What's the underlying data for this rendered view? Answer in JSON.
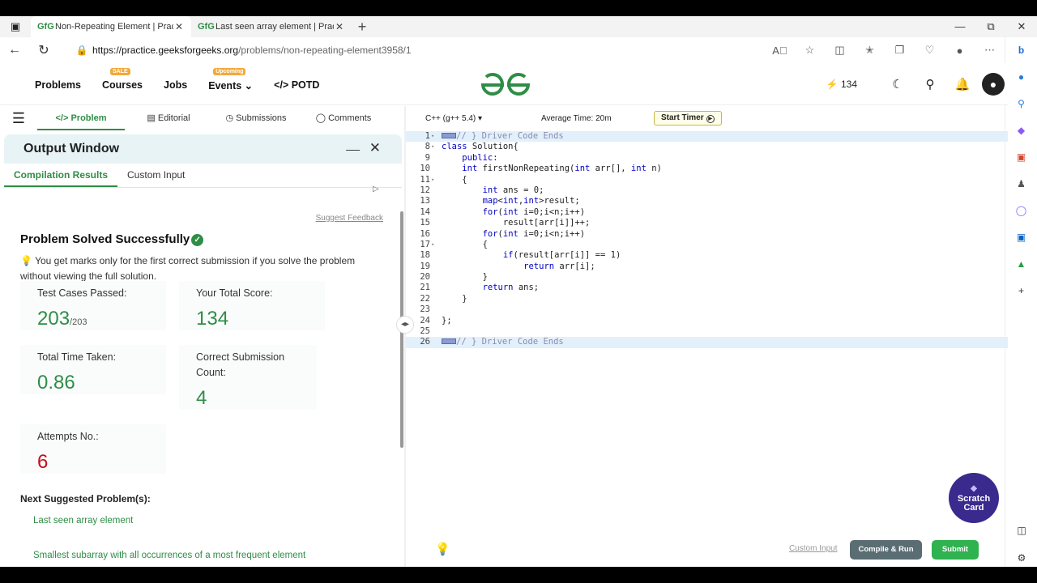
{
  "browser": {
    "tabs": [
      {
        "title": "Non-Repeating Element | Practic",
        "favicon": "GfG"
      },
      {
        "title": "Last seen array element | Practic",
        "favicon": "GfG"
      }
    ],
    "url_domain": "https://practice.geeksforgeeks.org",
    "url_path": "/problems/non-repeating-element3958/1"
  },
  "site": {
    "nav": [
      {
        "label": "Problems"
      },
      {
        "label": "Courses",
        "badge": "SALE"
      },
      {
        "label": "Jobs"
      },
      {
        "label": "Events",
        "badge": "Upcoming"
      },
      {
        "label": "POTD"
      }
    ],
    "logo": "GfG",
    "streak": "134"
  },
  "panel": {
    "tabs": [
      "Problem",
      "Editorial",
      "Submissions",
      "Comments"
    ],
    "output_title": "Output Window",
    "subtabs": [
      "Compilation Results",
      "Custom Input"
    ],
    "suggest_feedback": "Suggest Feedback",
    "status": "Problem Solved Successfully",
    "tip": "You get marks only for the first correct submission if you solve the problem without viewing the full solution.",
    "stats": {
      "test_cases_label": "Test Cases Passed:",
      "test_cases_value": "203",
      "test_cases_total": "/203",
      "score_label": "Your Total Score:",
      "score_value": "134",
      "time_label": "Total Time Taken:",
      "time_value": "0.86",
      "correct_label": "Correct Submission Count:",
      "correct_value": "4",
      "attempts_label": "Attempts No.:",
      "attempts_value": "6"
    },
    "next_title": "Next Suggested Problem(s):",
    "next": [
      "Last seen array element",
      "Smallest subarray with all occurrences of a most frequent element"
    ]
  },
  "editor": {
    "language": "C++ (g++ 5.4)",
    "avg_time": "Average Time: 20m",
    "start_timer": "Start Timer",
    "lines": [
      {
        "n": "1",
        "text": "// } Driver Code Ends",
        "type": "comment",
        "fold": true
      },
      {
        "n": "8",
        "text": "class Solution{",
        "fold": true
      },
      {
        "n": "9",
        "text": "    public:"
      },
      {
        "n": "10",
        "text": "    int firstNonRepeating(int arr[], int n)"
      },
      {
        "n": "11",
        "text": "    {",
        "fold": true
      },
      {
        "n": "12",
        "text": "        int ans = 0;"
      },
      {
        "n": "13",
        "text": "        map<int,int>result;"
      },
      {
        "n": "14",
        "text": "        for(int i=0;i<n;i++)"
      },
      {
        "n": "15",
        "text": "            result[arr[i]]++;"
      },
      {
        "n": "16",
        "text": "        for(int i=0;i<n;i++)"
      },
      {
        "n": "17",
        "text": "        {",
        "fold": true
      },
      {
        "n": "18",
        "text": "            if(result[arr[i]] == 1)"
      },
      {
        "n": "19",
        "text": "                return arr[i];"
      },
      {
        "n": "20",
        "text": "        }"
      },
      {
        "n": "21",
        "text": "        return ans;"
      },
      {
        "n": "22",
        "text": "    }"
      },
      {
        "n": "23",
        "text": ""
      },
      {
        "n": "24",
        "text": "};"
      },
      {
        "n": "25",
        "text": ""
      },
      {
        "n": "26",
        "text": "// } Driver Code Ends",
        "type": "comment"
      }
    ],
    "custom_input": "Custom Input",
    "compile_run": "Compile & Run",
    "submit": "Submit",
    "scratch_card": "Scratch Card"
  },
  "colors": {
    "accent": "#2f8d46",
    "attempts": "#c0121b",
    "submit": "#2fb24f"
  }
}
